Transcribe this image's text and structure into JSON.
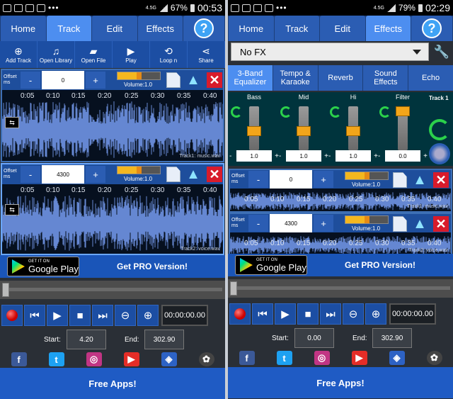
{
  "left": {
    "status": {
      "signal_label": "4.5G",
      "battery": "67%",
      "time": "00:53"
    },
    "tabs": [
      {
        "label": "Home"
      },
      {
        "label": "Track"
      },
      {
        "label": "Edit"
      },
      {
        "label": "Effects"
      },
      {
        "label": "?"
      }
    ],
    "toolbar": [
      {
        "label": "Add Track",
        "icon": "add-icon"
      },
      {
        "label": "Open Library",
        "icon": "library-icon"
      },
      {
        "label": "Open File",
        "icon": "folder-icon"
      },
      {
        "label": "Play",
        "icon": "play-icon"
      },
      {
        "label": "Loop n",
        "icon": "loop-icon"
      },
      {
        "label": "Share",
        "icon": "share-icon"
      }
    ],
    "tracks": [
      {
        "offset_label": "Offset ms",
        "offset_value": "0",
        "volume": "Volume:1.0",
        "name": "Track1: music.wav",
        "times": [
          "0:05",
          "0:10",
          "0:15",
          "0:20",
          "0:25",
          "0:30",
          "0:35",
          "0:40"
        ],
        "selected": false
      },
      {
        "offset_label": "Offset ms",
        "offset_value": "4300",
        "volume": "Volume:1.0",
        "name": "Track2: voice.wav",
        "times": [
          "0:05",
          "0:10",
          "0:15",
          "0:20",
          "0:25",
          "0:30",
          "0:35",
          "0:40"
        ],
        "selected": true
      }
    ],
    "get_it_on": "GET IT ON",
    "google_play": "Google Play",
    "pro": "Get PRO Version!",
    "time_display": "00:00:00.00",
    "start_label": "Start:",
    "start_value": "4.20",
    "end_label": "End:",
    "end_value": "302.90",
    "free_apps": "Free Apps!"
  },
  "right": {
    "status": {
      "signal_label": "4.5G",
      "battery": "79%",
      "time": "02:29"
    },
    "tabs": [
      {
        "label": "Home"
      },
      {
        "label": "Track"
      },
      {
        "label": "Edit"
      },
      {
        "label": "Effects"
      },
      {
        "label": "?"
      }
    ],
    "fx_select": "No FX",
    "fx_tabs": [
      "3-Band Equalizer",
      "Tempo & Karaoke",
      "Reverb",
      "Sound Effects",
      "Echo"
    ],
    "bands": [
      {
        "label": "Bass",
        "value": "1.0",
        "level": 0.35
      },
      {
        "label": "Mid",
        "value": "1.0",
        "level": 0.35
      },
      {
        "label": "Hi",
        "value": "1.0",
        "level": 0.35
      },
      {
        "label": "Filter",
        "value": "0.0",
        "level": 1.0
      }
    ],
    "track_label": "Track 1",
    "tracks": [
      {
        "offset_label": "Offset ms",
        "offset_value": "0",
        "volume": "Volume:1.0",
        "name": "Track1: music.wav",
        "times": [
          "0:05",
          "0:10",
          "0:15",
          "0:20",
          "0:25",
          "0:30",
          "0:35",
          "0:40"
        ]
      },
      {
        "offset_label": "Offset ms",
        "offset_value": "4300",
        "volume": "Volume:1.0",
        "name": "Track2: voice.wav",
        "times": [
          "0:05",
          "0:10",
          "0:15",
          "0:20",
          "0:25",
          "0:30",
          "0:35",
          "0:40"
        ]
      }
    ],
    "get_it_on": "GET IT ON",
    "google_play": "Google Play",
    "pro": "Get PRO Version!",
    "time_display": "00:00:00.00",
    "start_label": "Start:",
    "start_value": "0.00",
    "end_label": "End:",
    "end_value": "302.90",
    "free_apps": "Free Apps!"
  },
  "colors": {
    "tab_active": "#4d8ef0",
    "tab": "#2b5db3",
    "toolbar": "#1c4ea3",
    "wave": "#7ea6ff",
    "close": "#d81b2b"
  },
  "social": [
    {
      "name": "facebook-icon",
      "glyph": "f",
      "color": "#3b5998"
    },
    {
      "name": "twitter-icon",
      "glyph": "t",
      "color": "#1da1f2"
    },
    {
      "name": "instagram-icon",
      "glyph": "◎",
      "color": "#c13584"
    },
    {
      "name": "youtube-icon",
      "glyph": "▶",
      "color": "#e52d27"
    },
    {
      "name": "app-icon",
      "glyph": "◈",
      "color": "#2d62c4"
    },
    {
      "name": "film-icon",
      "glyph": "✿",
      "color": "#444"
    }
  ]
}
